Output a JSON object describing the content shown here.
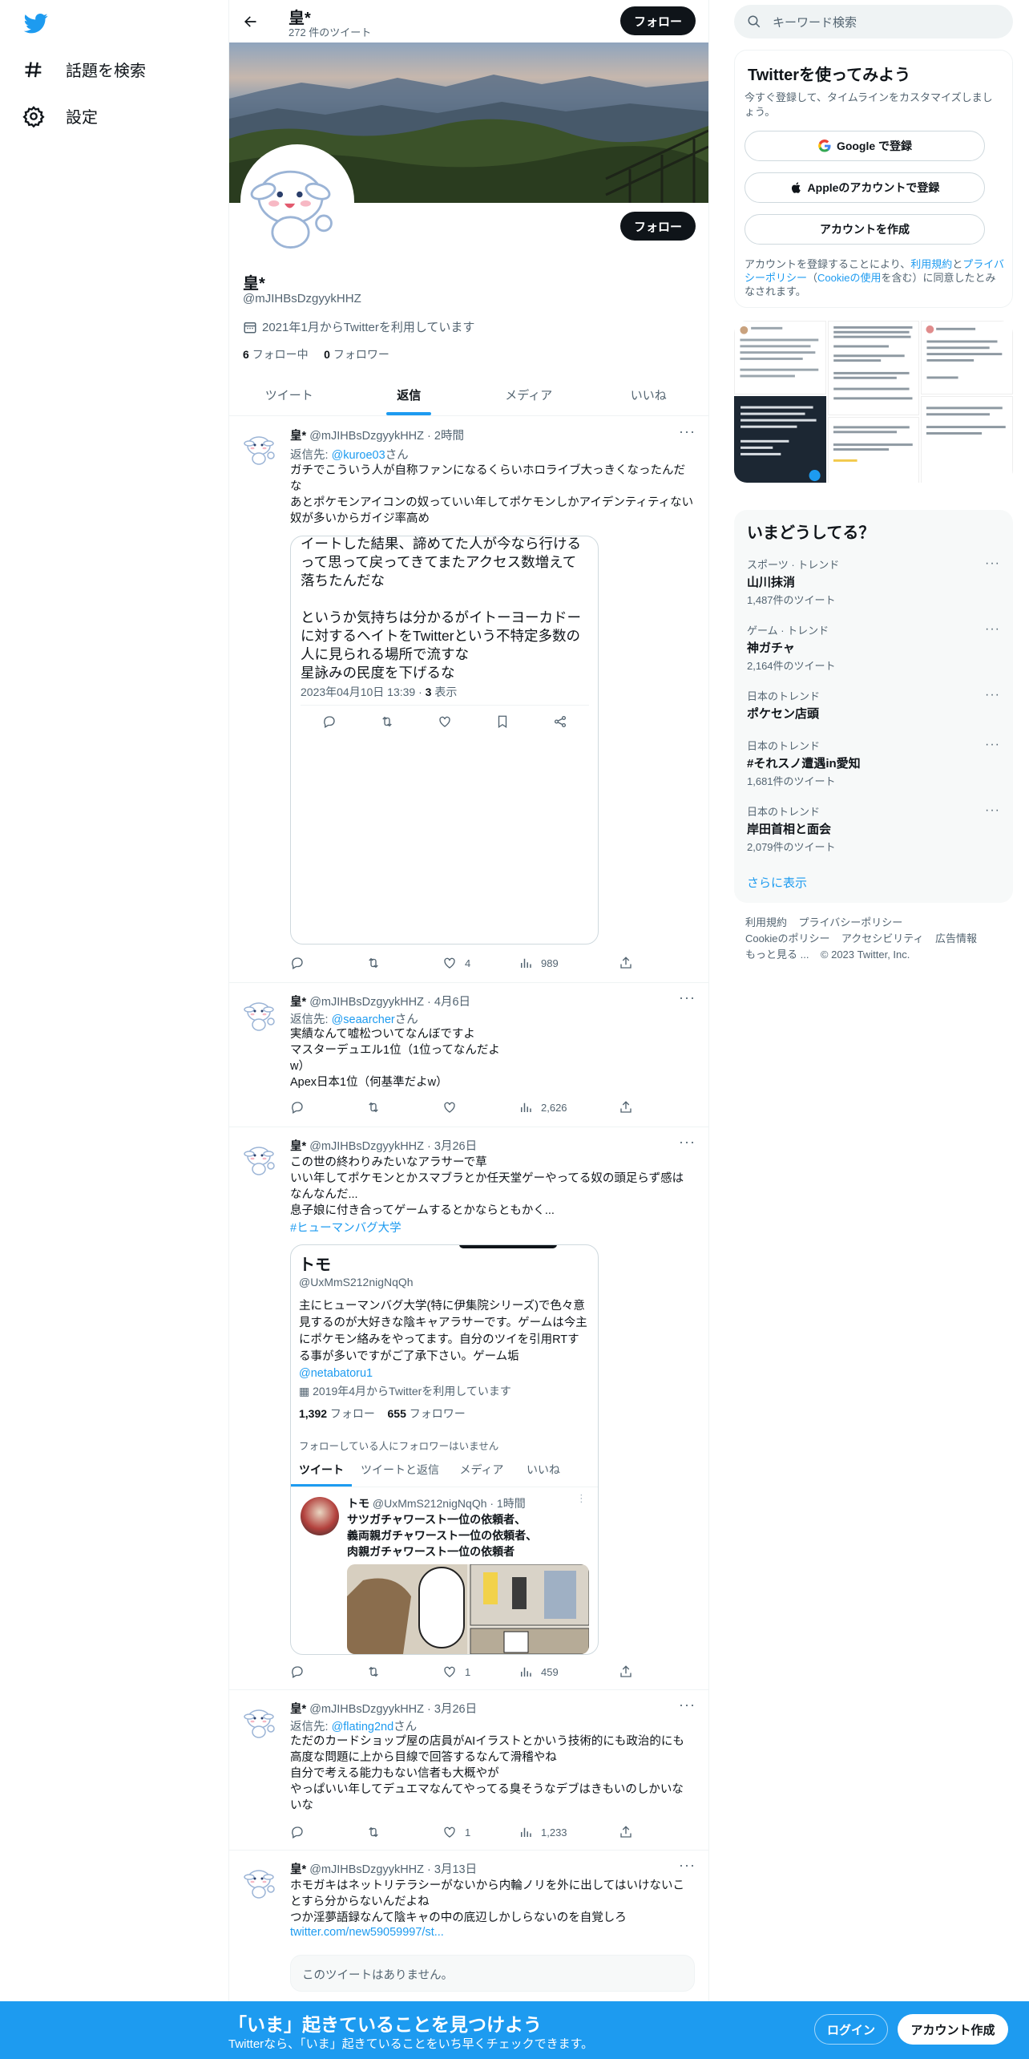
{
  "nav": {
    "explore": "話題を検索",
    "settings": "設定"
  },
  "profile": {
    "name": "皇*",
    "tweet_count": "272 件のツイート",
    "follow_label": "フォロー",
    "handle": "@mJIHBsDzgyykHHZ",
    "joined": "2021年1月からTwitterを利用しています",
    "following_num": "6",
    "following_label": "フォロー中",
    "followers_num": "0",
    "followers_label": "フォロワー",
    "tabs": [
      "ツイート",
      "返信",
      "メディア",
      "いいね"
    ],
    "active_tab": "返信"
  },
  "tweets": [
    {
      "name": "皇*",
      "handle": "@mJIHBsDzgyykHHZ",
      "time": "2時間",
      "reply_prefix": "返信先: ",
      "reply_to": "@kuroe03",
      "reply_suffix": "さん",
      "text": "ガチでこういう人が自称ファンになるくらいホロライブ大っきくなったんだな\nあとポケモンアイコンの奴っていい年してポケモンしかアイデンティティない奴が多いからガイジ率高め",
      "embed_text": "イートした結果、諦めてた人が今なら行けるって思って戻ってきてまたアクセス数増えて落ちたんだな\n\nというか気持ちは分かるがイトーヨーカドーに対するヘイトをTwitterという不特定多数の人に見られる場所で流すな\n星詠みの民度を下げるな",
      "embed_meta_date": "2023年04月10日 13:39 · ",
      "embed_meta_views_num": "3",
      "embed_meta_views_label": " 表示",
      "likes": "4",
      "views": "989"
    },
    {
      "name": "皇*",
      "handle": "@mJIHBsDzgyykHHZ",
      "time": "4月6日",
      "reply_prefix": "返信先: ",
      "reply_to": "@seaarcher",
      "reply_suffix": "さん",
      "text": "実績なんて嘘松ついてなんぼですよ\nマスターデュエル1位（1位ってなんだよ\nw）\nApex日本1位（何基準だよw）",
      "views": "2,626"
    },
    {
      "name": "皇*",
      "handle": "@mJIHBsDzgyykHHZ",
      "time": "3月26日",
      "text": "この世の終わりみたいなアラサーで草\nいい年してポケモンとかスマブラとか任天堂ゲーやってる奴の頭足らず感はなんなんだ...\n息子娘に付き合ってゲームするとかならともかく...",
      "hashtag": "#ヒューマンバグ大学",
      "card": {
        "name": "トモ",
        "handle": "@UxMmS212nigNqQh",
        "bio": "主にヒューマンバグ大学(特に伊集院シリーズ)で色々意見するのが大好きな陰キャアラサーです。ゲームは今主にポケモン絡みをやってます。自分のツイを引用RTする事が多いですがご了承下さい。ゲーム垢",
        "bio_link": "@netabatoru1",
        "joined": "2019年4月からTwitterを利用しています",
        "following_num": "1,392",
        "following_label": " フォロー",
        "followers_num": "655",
        "followers_label": " フォロワー",
        "no_mutual": "フォローしている人にフォロワーはいません",
        "tabs": [
          "ツイート",
          "ツイートと返信",
          "メディア",
          "いいね"
        ],
        "inner_name": "トモ",
        "inner_handle": "@UxMmS212nigNqQh · 1時間",
        "inner_text": "サツガチャワースト一位の依頼者、\n義両親ガチャワースト一位の依頼者、\n肉親ガチャワースト一位の依頼者"
      },
      "likes": "1",
      "views": "459"
    },
    {
      "name": "皇*",
      "handle": "@mJIHBsDzgyykHHZ",
      "time": "3月26日",
      "reply_prefix": "返信先: ",
      "reply_to": "@flating2nd",
      "reply_suffix": "さん",
      "text": "ただのカードショップ屋の店員がAIイラストとかいう技術的にも政治的にも高度な問題に上から目線で回答するなんて滑稽やね\n自分で考える能力もない信者も大概やが\nやっぱいい年してデュエマなんてやってる臭そうなデブはきもいのしかいないな",
      "likes": "1",
      "views": "1,233"
    },
    {
      "name": "皇*",
      "handle": "@mJIHBsDzgyykHHZ",
      "time": "3月13日",
      "text": "ホモガキはネットリテラシーがないから内輪ノリを外に出してはいけないことすら分からないんだよね\nつか淫夢語録なんて陰キャの中の底辺しかしらないのを自覚しろ",
      "link": "twitter.com/new59059997/st...",
      "unavailable": "このツイートはありません。"
    }
  ],
  "right": {
    "search_placeholder": "キーワード検索",
    "signup_title": "Twitterを使ってみよう",
    "signup_sub": "今すぐ登録して、タイムラインをカスタマイズしましょう。",
    "google_btn": "Google で登録",
    "apple_btn": "Appleのアカウントで登録",
    "create_btn": "アカウントを作成",
    "terms_1": "アカウントを登録することにより、",
    "terms_link1": "利用規約",
    "terms_2": "と",
    "terms_link2": "プライバシーポリシー",
    "terms_3": "（",
    "terms_link3": "Cookieの使用",
    "terms_4": "を含む）に同意したとみなされます。",
    "trends_title": "いまどうしてる？",
    "trends": [
      {
        "cat": "スポーツ · トレンド",
        "name": "山川抹消",
        "count": "1,487件のツイート"
      },
      {
        "cat": "ゲーム · トレンド",
        "name": "神ガチャ",
        "count": "2,164件のツイート"
      },
      {
        "cat": "日本のトレンド",
        "name": "ポケセン店頭",
        "count": ""
      },
      {
        "cat": "日本のトレンド",
        "name": "#それスノ遭遇in愛知",
        "count": "1,681件のツイート"
      },
      {
        "cat": "日本のトレンド",
        "name": "岸田首相と面会",
        "count": "2,079件のツイート"
      }
    ],
    "show_more": "さらに表示",
    "footer": [
      "利用規約",
      "プライバシーポリシー",
      "Cookieのポリシー",
      "アクセシビリティ",
      "広告情報",
      "もっと見る ...",
      "© 2023 Twitter, Inc."
    ]
  },
  "bottom": {
    "title": "「いま」起きていることを見つけよう",
    "sub": "Twitterなら、「いま」起きていることをいち早くチェックできます。",
    "login": "ログイン",
    "signup": "アカウント作成"
  },
  "colors": {
    "accent": "#1d9bf0",
    "text": "#0f1419",
    "muted": "#536471"
  }
}
